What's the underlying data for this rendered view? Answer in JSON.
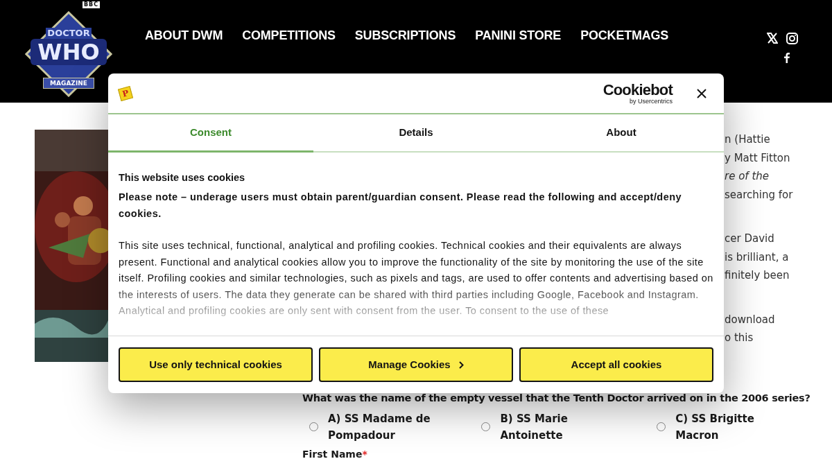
{
  "header": {
    "logo": {
      "bbc": "BBC",
      "line_1": "DOCTOR",
      "line_2": "WHO",
      "line_3": "MAGAZINE"
    },
    "nav": [
      "ABOUT DWM",
      "COMPETITIONS",
      "SUBSCRIPTIONS",
      "PANINI STORE",
      "POCKETMAGS"
    ]
  },
  "article": {
    "paragraphs": [
      [
        {
          "text": "n (Hattie",
          "italic": false
        },
        {
          "text": "y Matt Fitton",
          "italic": false
        },
        {
          "text": "re of the",
          "italic": true
        },
        {
          "text": "searching for",
          "italic": false
        }
      ],
      [
        {
          "text": "cer David",
          "italic": false
        },
        {
          "text": "is brilliant, a",
          "italic": false
        },
        {
          "text": "finitely been",
          "italic": false
        }
      ],
      [
        {
          "text": "download",
          "italic": false
        },
        {
          "text": "o this",
          "italic": false
        }
      ]
    ]
  },
  "quiz": {
    "question": "What was the name of the empty vessel that the Tenth Doctor arrived on in the 2006 series?",
    "options": [
      {
        "label": "A) SS Madame de Pompadour",
        "selected": false
      },
      {
        "label": "B) SS Marie Antoinette",
        "selected": false
      },
      {
        "label": "C) SS Brigitte Macron",
        "selected": false
      }
    ],
    "field_label": "First Name",
    "required_mark": "*"
  },
  "cookie_dialog": {
    "publisher_logo": "P",
    "brand": "Cookiebot",
    "brand_sub": "by Usercentrics",
    "tabs": [
      {
        "label": "Consent",
        "selected": true
      },
      {
        "label": "Details",
        "selected": false
      },
      {
        "label": "About",
        "selected": false
      }
    ],
    "title": "This website uses cookies",
    "note": "Please note – underage users must obtain parent/guardian consent. Please read the following and accept/deny cookies.",
    "body": "This site uses technical, functional, analytical and profiling cookies. Technical cookies and their equivalents are always present.  Functional and analytical cookies allow you to improve the functionality of the site by monitoring the use of the site itself.  Profiling cookies and similar technologies, such as pixels and tags, are used to offer contents and advertising based on the interests of users.  The data they generate can be shared with third parties including Google, Facebook and Instagram. Analytical and profiling cookies are only sent with consent from the user.  To consent to the use of these",
    "buttons": [
      {
        "label": "Use only technical cookies",
        "kind": "plain"
      },
      {
        "label": "Manage Cookies",
        "kind": "more"
      },
      {
        "label": "Accept all cookies",
        "kind": "plain"
      }
    ]
  }
}
